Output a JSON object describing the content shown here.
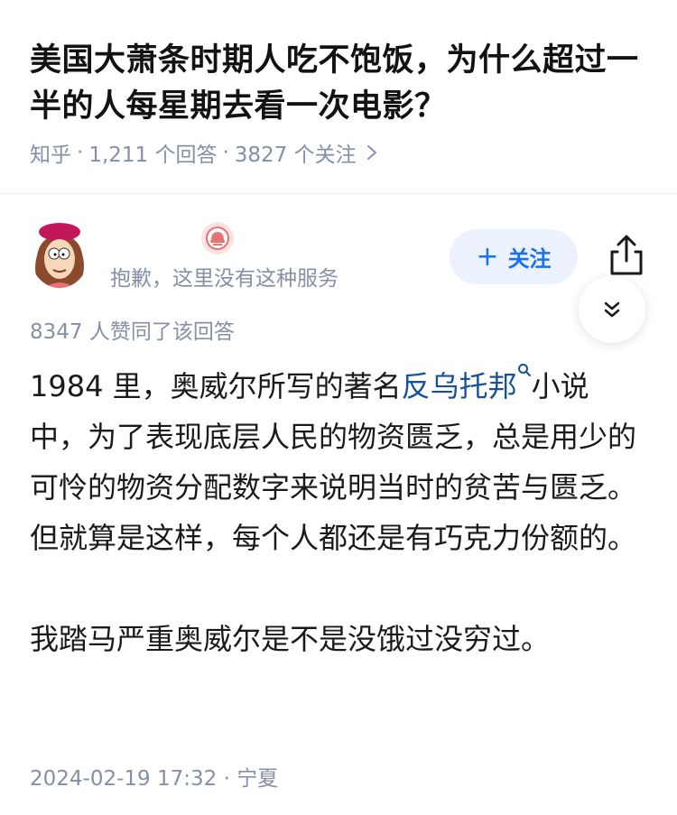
{
  "question": {
    "title": "美国大萧条时期人吃不饱饭，为什么超过一半的人每星期去看一次电影？",
    "source": "知乎",
    "answer_count": "1,211 个回答",
    "follower_count": "3827 个关注",
    "separator": "·"
  },
  "author": {
    "name": "",
    "bio": "抱歉，这里没有这种服务",
    "follow_label": "关注",
    "badge_icon": "helmet-badge-icon",
    "badge_color": "#fde2e1"
  },
  "answer": {
    "votes": "8347 人赞同了该回答",
    "p1_pre": "1984 里，奥威尔所写的著名",
    "p1_link": "反乌托邦",
    "p1_post": "小说中，为了表现底层人民的物资匮乏，总是用少的可怜的物资分配数字来说明当时的贫苦与匮乏。但就算是这样，每个人都还是有巧克力份额的。",
    "p2": "我踏马严重奥威尔是不是没饿过没穷过。",
    "timestamp": "2024-02-19 17:32",
    "location": "宁夏"
  },
  "colors": {
    "accent": "#1772f6",
    "link": "#175199",
    "meta": "#8590a6"
  }
}
